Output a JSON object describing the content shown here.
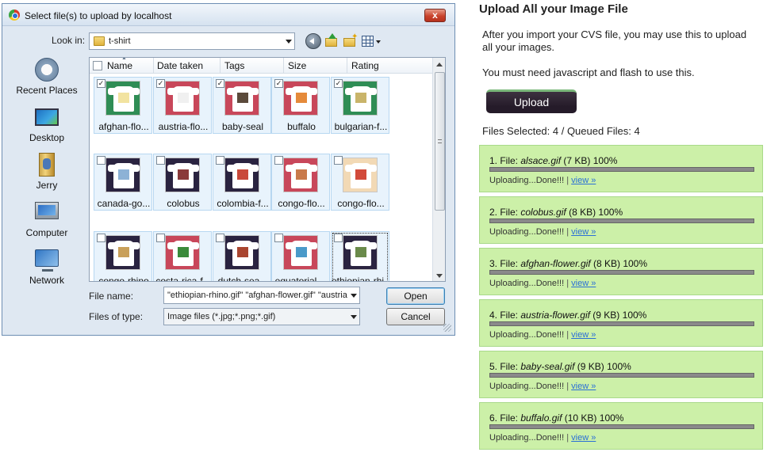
{
  "dialog": {
    "title": "Select file(s) to upload by localhost",
    "close_glyph": "x",
    "look_in_label": "Look in:",
    "look_in_value": "t-shirt",
    "places": [
      {
        "label": "Recent Places",
        "icon": "recent-places-icon"
      },
      {
        "label": "Desktop",
        "icon": "desktop-icon"
      },
      {
        "label": "Jerry",
        "icon": "user-folder-icon"
      },
      {
        "label": "Computer",
        "icon": "computer-icon"
      },
      {
        "label": "Network",
        "icon": "network-icon"
      }
    ],
    "columns": [
      "Name",
      "Date taken",
      "Tags",
      "Size",
      "Rating"
    ],
    "files": [
      {
        "name": "afghan-flo...",
        "selected": true,
        "shirt": "#2f8d55",
        "design": "#f2e3a0"
      },
      {
        "name": "austria-flo...",
        "selected": true,
        "shirt": "#c8475a",
        "design": "#f0f0f0"
      },
      {
        "name": "baby-seal",
        "selected": true,
        "shirt": "#c8475a",
        "design": "#5b4a3b"
      },
      {
        "name": "buffalo",
        "selected": true,
        "shirt": "#c8475a",
        "design": "#e58a3a"
      },
      {
        "name": "bulgarian-f...",
        "selected": true,
        "shirt": "#2f8d55",
        "design": "#c9b46a"
      },
      {
        "name": "canada-go...",
        "selected": false,
        "shirt": "#2a2340",
        "design": "#8db2d6"
      },
      {
        "name": "colobus",
        "selected": false,
        "shirt": "#2a2340",
        "design": "#8a3a3a"
      },
      {
        "name": "colombia-f...",
        "selected": false,
        "shirt": "#2a2340",
        "design": "#c9493a"
      },
      {
        "name": "congo-flo...",
        "selected": false,
        "shirt": "#c8475a",
        "design": "#c97a4a"
      },
      {
        "name": "congo-flo...",
        "selected": false,
        "shirt": "#f2d9b5",
        "design": "#d24a3a"
      },
      {
        "name": "congo-rhino",
        "selected": false,
        "shirt": "#2a2340",
        "design": "#c9a05a"
      },
      {
        "name": "costa-rica-f...",
        "selected": false,
        "shirt": "#c8475a",
        "design": "#3a8a3a"
      },
      {
        "name": "dutch-sea...",
        "selected": false,
        "shirt": "#2a2340",
        "design": "#a9452f"
      },
      {
        "name": "equatorial-...",
        "selected": false,
        "shirt": "#c8475a",
        "design": "#4a9ac9"
      },
      {
        "name": "ethiopian-rhi...",
        "selected": false,
        "shirt": "#2a2340",
        "design": "#6a8a4a"
      }
    ],
    "file_name_label": "File name:",
    "file_name_value": "\"ethiopian-rhino.gif\" \"afghan-flower.gif\" \"austria",
    "files_of_type_label": "Files of type:",
    "files_of_type_value": "Image files (*.jpg;*.png;*.gif)",
    "open_label": "Open",
    "cancel_label": "Cancel"
  },
  "panel": {
    "title": "Upload All your Image File",
    "intro": "After you import your CVS file, you may use this to upload all your images.",
    "requirement": "You must need javascript and flash to use this.",
    "upload_label": "Upload",
    "files_status": "Files Selected: 4 / Queued Files: 4",
    "queue": [
      {
        "prefix": "1. File: ",
        "file": "alsace.gif",
        "size": " (7 KB) ",
        "percent": "100%",
        "progress": 1.0,
        "status": "Uploading...Done!!!",
        "sep": " | ",
        "link": "view »"
      },
      {
        "prefix": "2. File: ",
        "file": "colobus.gif",
        "size": " (8 KB) ",
        "percent": "100%",
        "progress": 1.0,
        "status": "Uploading...Done!!!",
        "sep": " | ",
        "link": "view »"
      },
      {
        "prefix": "3. File: ",
        "file": "afghan-flower.gif",
        "size": " (8 KB) ",
        "percent": "100%",
        "progress": 1.0,
        "status": "Uploading...Done!!!",
        "sep": " | ",
        "link": "view »"
      },
      {
        "prefix": "4. File: ",
        "file": "austria-flower.gif",
        "size": " (9 KB) ",
        "percent": "100%",
        "progress": 1.0,
        "status": "Uploading...Done!!!",
        "sep": " | ",
        "link": "view »"
      },
      {
        "prefix": "5. File: ",
        "file": "baby-seal.gif",
        "size": " (9 KB) ",
        "percent": "100%",
        "progress": 1.0,
        "status": "Uploading...Done!!!",
        "sep": " | ",
        "link": "view »"
      },
      {
        "prefix": "6. File: ",
        "file": "buffalo.gif",
        "size": " (10 KB) ",
        "percent": "100%",
        "progress": 1.0,
        "status": "Uploading...Done!!!",
        "sep": " | ",
        "link": "view »"
      }
    ]
  }
}
